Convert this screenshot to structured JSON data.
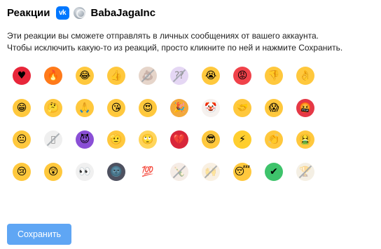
{
  "header": {
    "title": "Реакции",
    "vk_icon": "vk-logo-icon",
    "vk_icon_text": "vk",
    "avatar_icon": "account-avatar",
    "account_name": "BabaJagaInc"
  },
  "description": {
    "line1": "Эти реакции вы сможете отправлять в личных сообщениях от вашего аккаунта.",
    "line2": "Чтобы исключить какую-то из реакций, просто кликните по ней и нажмите Сохранить."
  },
  "reactions": [
    {
      "name": "red-heart",
      "glyph": "♥",
      "color": "#e8263a",
      "disabled": false
    },
    {
      "name": "fire",
      "glyph": "🔥",
      "color": "#ff7a1a",
      "disabled": false
    },
    {
      "name": "tears-of-joy",
      "glyph": "😂",
      "color": "#ffc83d",
      "disabled": false
    },
    {
      "name": "thumbs-up",
      "glyph": "👍",
      "color": "#ffc83d",
      "disabled": false
    },
    {
      "name": "pile-of-poo",
      "glyph": "💩",
      "color": "#c9a48c",
      "disabled": true
    },
    {
      "name": "question-marks",
      "glyph": "⁇",
      "color": "#c6a8e8",
      "disabled": true
    },
    {
      "name": "loudly-crying",
      "glyph": "😭",
      "color": "#ffc83d",
      "disabled": false
    },
    {
      "name": "angry-face",
      "glyph": "😡",
      "color": "#f0424a",
      "disabled": false
    },
    {
      "name": "thumbs-down",
      "glyph": "👎",
      "color": "#ffc83d",
      "disabled": false
    },
    {
      "name": "ok-hand",
      "glyph": "👌",
      "color": "#ffc83d",
      "disabled": false
    },
    {
      "name": "grinning-face",
      "glyph": "😁",
      "color": "#ffc83d",
      "disabled": false
    },
    {
      "name": "thinking-face",
      "glyph": "🤔",
      "color": "#ffc83d",
      "disabled": false
    },
    {
      "name": "folded-hands",
      "glyph": "🙏",
      "color": "#ffc83d",
      "disabled": false
    },
    {
      "name": "kissing-heart",
      "glyph": "😘",
      "color": "#ffc83d",
      "disabled": false
    },
    {
      "name": "heart-eyes",
      "glyph": "😍",
      "color": "#ffc83d",
      "disabled": false
    },
    {
      "name": "party-popper",
      "glyph": "🎉",
      "color": "#f2a93b",
      "disabled": false
    },
    {
      "name": "clown-face",
      "glyph": "🤡",
      "color": "#f6f1ee",
      "disabled": false
    },
    {
      "name": "handshake",
      "glyph": "🤝",
      "color": "#ffc83d",
      "disabled": false
    },
    {
      "name": "screaming-in-fear",
      "glyph": "😱",
      "color": "#ffc83d",
      "disabled": false
    },
    {
      "name": "cursing-face",
      "glyph": "🤬",
      "color": "#e53846",
      "disabled": false
    },
    {
      "name": "neutral-face",
      "glyph": "😐",
      "color": "#ffc83d",
      "disabled": false
    },
    {
      "name": "page-document",
      "glyph": "▯",
      "color": "#dcdcdc",
      "disabled": true
    },
    {
      "name": "smiling-devil",
      "glyph": "😈",
      "color": "#8a4fd6",
      "disabled": false
    },
    {
      "name": "saluting-face",
      "glyph": "🫡",
      "color": "#ffc83d",
      "disabled": false
    },
    {
      "name": "rolling-eyes",
      "glyph": "🙄",
      "color": "#ffd55a",
      "disabled": false
    },
    {
      "name": "broken-heart",
      "glyph": "💔",
      "color": "#d8263a",
      "disabled": false
    },
    {
      "name": "sunglasses-face",
      "glyph": "😎",
      "color": "#ffc83d",
      "disabled": false
    },
    {
      "name": "lightning",
      "glyph": "⚡",
      "color": "#ffce2e",
      "disabled": false
    },
    {
      "name": "clapping-hands",
      "glyph": "👏",
      "color": "#ffc83d",
      "disabled": false
    },
    {
      "name": "vomiting-face",
      "glyph": "🤮",
      "color": "#ffc83d",
      "disabled": false
    },
    {
      "name": "sad-face",
      "glyph": "😢",
      "color": "#ffc83d",
      "disabled": false
    },
    {
      "name": "astonished-face",
      "glyph": "😲",
      "color": "#ffc83d",
      "disabled": false
    },
    {
      "name": "eyes",
      "glyph": "👀",
      "color": "#f0f0f0",
      "disabled": false
    },
    {
      "name": "new-moon-face",
      "glyph": "🌚",
      "color": "#4e5160",
      "disabled": false
    },
    {
      "name": "hundred-points",
      "glyph": "💯",
      "color": "#ffffff",
      "disabled": false
    },
    {
      "name": "bottle-with-cork",
      "glyph": "🍾",
      "color": "#e9d6c8",
      "disabled": true
    },
    {
      "name": "raising-hands",
      "glyph": "🙌",
      "color": "#f3dfbf",
      "disabled": true
    },
    {
      "name": "sleeping-face",
      "glyph": "😴",
      "color": "#ffc83d",
      "disabled": false
    },
    {
      "name": "check-mark",
      "glyph": "✔",
      "color": "#3ec36b",
      "disabled": false
    },
    {
      "name": "trophy",
      "glyph": "🏆",
      "color": "#e8dcc4",
      "disabled": true
    }
  ],
  "save_button": {
    "label": "Сохранить"
  }
}
